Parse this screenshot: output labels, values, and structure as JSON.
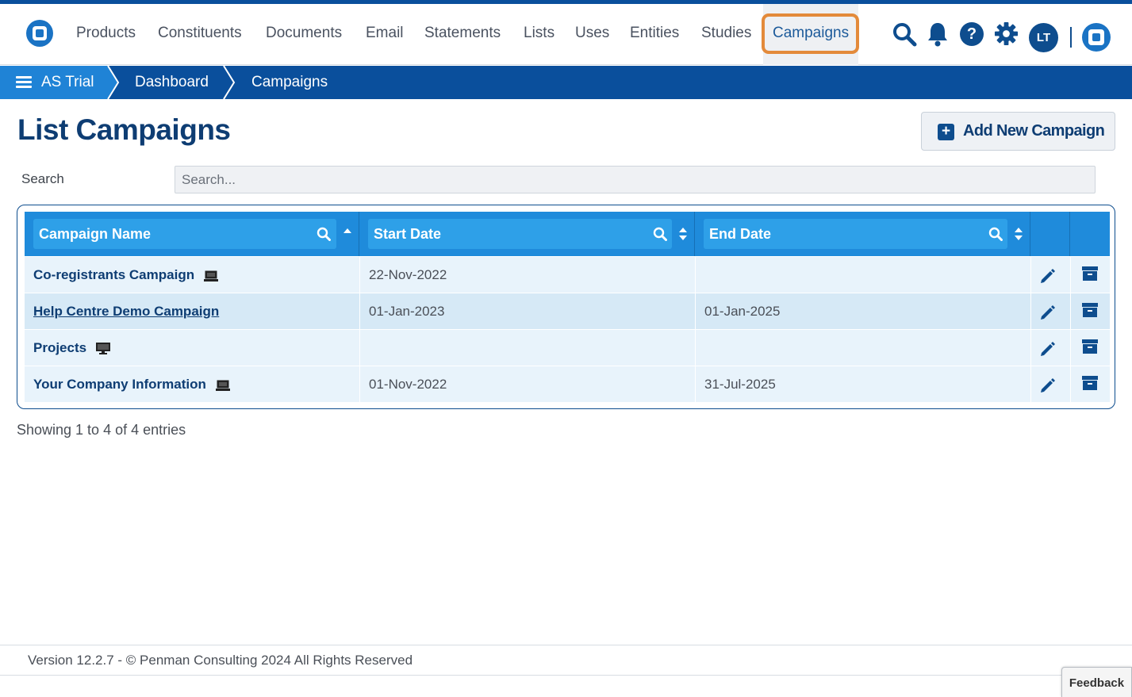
{
  "nav": {
    "items": [
      {
        "label": "Products"
      },
      {
        "label": "Constituents"
      },
      {
        "label": "Documents"
      },
      {
        "label": "Email"
      },
      {
        "label": "Statements"
      },
      {
        "label": "Lists"
      },
      {
        "label": "Uses"
      },
      {
        "label": "Entities"
      },
      {
        "label": "Studies"
      },
      {
        "label": "Campaigns",
        "active": true
      }
    ],
    "avatar_initials": "LT",
    "icons": [
      "search-icon",
      "bell-icon",
      "help-icon",
      "gear-icon"
    ]
  },
  "breadcrumb": {
    "items": [
      "AS Trial",
      "Dashboard",
      "Campaigns"
    ]
  },
  "page": {
    "title": "List Campaigns",
    "add_button_label": "Add New Campaign",
    "search_label": "Search",
    "search_placeholder": "Search..."
  },
  "table": {
    "columns": [
      "Campaign Name",
      "Start Date",
      "End Date"
    ],
    "rows": [
      {
        "name": "Co-registrants Campaign",
        "start": "22-Nov-2022",
        "end": "",
        "icon": "laptop-icon"
      },
      {
        "name": "Help Centre Demo Campaign",
        "start": "01-Jan-2023",
        "end": "01-Jan-2025",
        "icon": ""
      },
      {
        "name": "Projects",
        "start": "",
        "end": "",
        "icon": "monitor-icon"
      },
      {
        "name": "Your Company Information",
        "start": "01-Nov-2022",
        "end": "31-Jul-2025",
        "icon": "laptop-icon"
      }
    ],
    "info": "Showing 1 to 4 of 4 entries"
  },
  "footer": {
    "text": "Version 12.2.7 - © Penman Consulting 2024 All Rights Reserved",
    "feedback": "Feedback"
  },
  "colors": {
    "brand_dark": "#0a4f9c",
    "brand_light": "#1f83d6",
    "highlight": "#e38a3a"
  }
}
